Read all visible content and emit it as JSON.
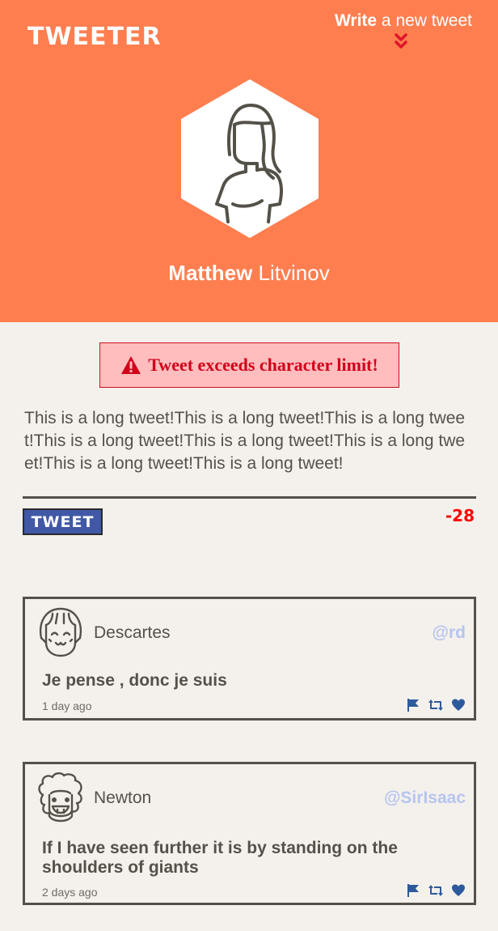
{
  "header": {
    "brand": "TWEETER",
    "write_bold": "Write",
    "write_rest": " a new tweet",
    "user_first": "Matthew",
    "user_last": "Litvinov"
  },
  "composer": {
    "error_message": "Tweet exceeds character limit!",
    "text": "This is a long tweet!This is a long tweet!This is a long tweet!This is a long tweet!This is a long tweet!This is a long tweet!This is a long tweet!This is a long tweet!",
    "button_label": "TWEET",
    "counter": "-28"
  },
  "tweets": [
    {
      "author": "Descartes",
      "handle": "@rd",
      "content": "Je pense , donc je suis",
      "time": "1 day ago"
    },
    {
      "author": "Newton",
      "handle": "@SirIsaac",
      "content": "If I have seen further it is by standing on the shoulders of giants",
      "time": "2 days ago"
    }
  ],
  "icons": {
    "write": "double-chevron-down-icon",
    "error": "warning-icon",
    "flag": "flag-icon",
    "retweet": "retweet-icon",
    "like": "heart-icon"
  },
  "colors": {
    "header_bg": "#ff7e4f",
    "page_bg": "#f4f1ec",
    "text": "#545149",
    "error": "#d0021b",
    "error_bg": "#ffbdbd",
    "button": "#4058a6",
    "handle": "#b6c4f0",
    "action_icon": "#2d5a9c"
  }
}
